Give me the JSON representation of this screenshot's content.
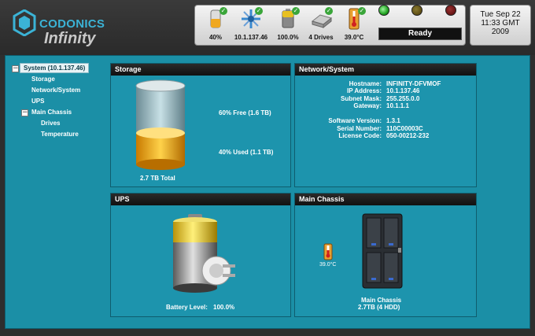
{
  "header": {
    "brand": "CODONICS",
    "product": "Infinity",
    "status_items": [
      {
        "icon": "storage-icon",
        "label": "40%"
      },
      {
        "icon": "network-icon",
        "label": "10.1.137.46"
      },
      {
        "icon": "battery-icon",
        "label": "100.0%"
      },
      {
        "icon": "drive-icon",
        "label": "4 Drives"
      },
      {
        "icon": "thermometer-icon",
        "label": "39.0°C"
      }
    ],
    "ready_text": "Ready",
    "date_line1": "Tue Sep 22",
    "date_line2": "11:33 GMT",
    "date_line3": "2009"
  },
  "tree": {
    "items": [
      {
        "label": "System (10.1.137.46)"
      },
      {
        "label": "Storage"
      },
      {
        "label": "Network/System"
      },
      {
        "label": "UPS"
      },
      {
        "label": "Main Chassis"
      },
      {
        "label": "Drives"
      },
      {
        "label": "Temperature"
      }
    ]
  },
  "storage": {
    "title": "Storage",
    "free_text": "60% Free (1.6 TB)",
    "used_text": "40% Used (1.1 TB)",
    "total_text": "2.7 TB Total",
    "used_fraction": 0.4
  },
  "network": {
    "title": "Network/System",
    "rows": [
      {
        "label": "Hostname:",
        "value": "INFINITY-DFVMOF"
      },
      {
        "label": "IP Address:",
        "value": "10.1.137.46"
      },
      {
        "label": "Subnet Mask:",
        "value": "255.255.0.0"
      },
      {
        "label": "Gateway:",
        "value": "10.1.1.1"
      },
      {
        "label": "Software Version:",
        "value": "1.3.1"
      },
      {
        "label": "Serial Number:",
        "value": "110C00003C"
      },
      {
        "label": "License Code:",
        "value": "050-00212-232"
      }
    ]
  },
  "ups": {
    "title": "UPS",
    "battery_label": "Battery Level:",
    "battery_value": "100.0%"
  },
  "chassis": {
    "title": "Main Chassis",
    "temp": "39.0°C",
    "caption1": "Main Chassis",
    "caption2": "2.7TB (4 HDD)"
  },
  "colors": {
    "accent": "#1b8fa6",
    "ready_green": "#38c038",
    "light_amber": "#5a4a10",
    "light_red": "#6a1010"
  }
}
